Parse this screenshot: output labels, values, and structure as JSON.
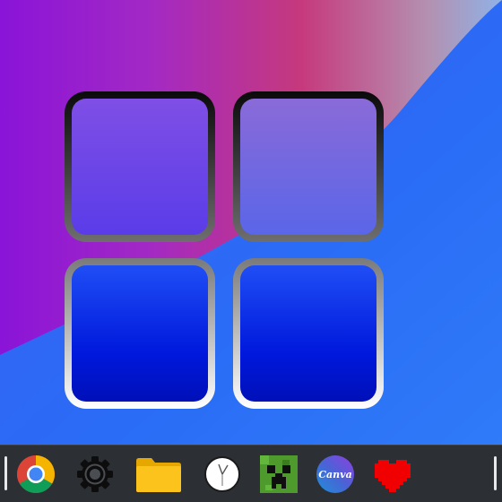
{
  "wallpaper": {
    "colors": {
      "purple": "#8a1fd6",
      "magenta": "#c0357a",
      "pale_blue": "#86a4e0",
      "blue": "#2d62f4"
    }
  },
  "launcher_tiles": [
    {
      "name": "tile-top-left"
    },
    {
      "name": "tile-top-right"
    },
    {
      "name": "tile-bottom-left"
    },
    {
      "name": "tile-bottom-right"
    }
  ],
  "taskbar": {
    "background": "#2c2f33",
    "apps": [
      {
        "icon": "chrome-icon"
      },
      {
        "icon": "settings-gear-icon"
      },
      {
        "icon": "folder-icon"
      },
      {
        "icon": "clock-icon"
      },
      {
        "icon": "minecraft-icon"
      },
      {
        "icon": "canva-icon",
        "label": "Canva"
      },
      {
        "icon": "heart-icon"
      }
    ]
  }
}
